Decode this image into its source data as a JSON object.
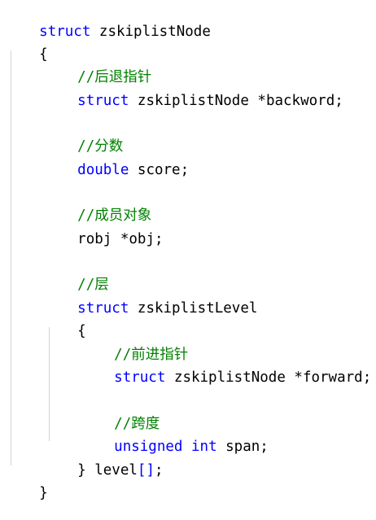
{
  "editor": {
    "colors": {
      "keyword": "#0000ff",
      "comment": "#008000",
      "text": "#000000",
      "indent_guide": "#d3d3d3",
      "background": "#ffffff"
    },
    "lines": {
      "l1_kw": "struct",
      "l1_name": " zskiplistNode",
      "l2": "{",
      "l3": "//后退指针",
      "l4_kw": "struct",
      "l4_rest": " zskiplistNode *backword;",
      "l6": "//分数",
      "l7_kw": "double",
      "l7_rest": " score;",
      "l9": "//成员对象",
      "l10": "robj *obj;",
      "l12": "//层",
      "l13_kw": "struct",
      "l13_rest": " zskiplistLevel",
      "l14": "{",
      "l15": "//前进指针",
      "l16_kw": "struct",
      "l16_rest": " zskiplistNode *forward;",
      "l18": "//跨度",
      "l19_kw1": "unsigned",
      "l19_sp1": " ",
      "l19_kw2": "int",
      "l19_rest": " span;",
      "l20_a": "} level",
      "l20_b": "[]",
      "l20_c": ";",
      "l21": "}"
    }
  }
}
